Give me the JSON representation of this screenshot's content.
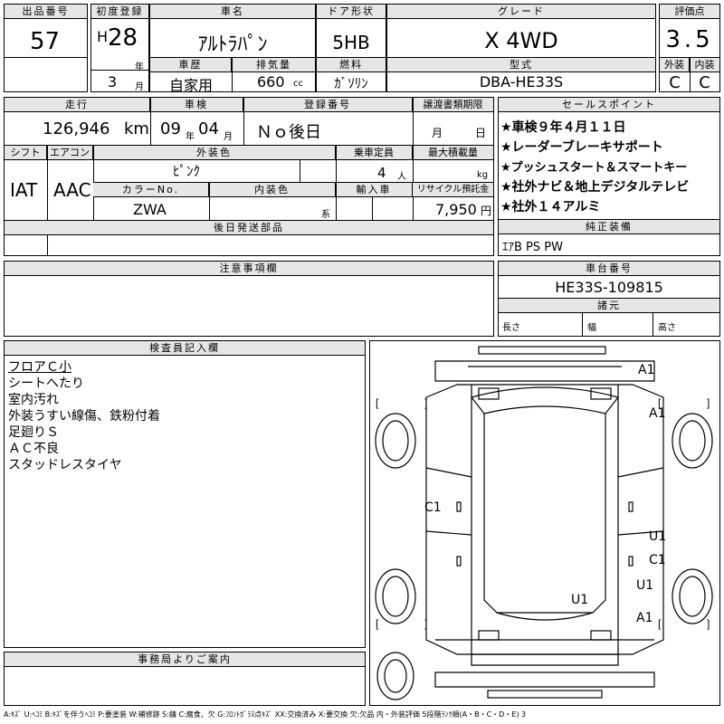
{
  "header": {
    "lot_label": "出品番号",
    "lot_no": "57",
    "first_reg_label": "初度登録",
    "era": "H",
    "year": "28",
    "year_unit": "年",
    "month": "3",
    "month_unit": "月",
    "name_label": "車名",
    "name": "ｱﾙﾄﾗﾊﾟﾝ",
    "door_label": "ドア形状",
    "door": "5HB",
    "grade_label": "グレード",
    "grade": "X 4WD",
    "score_label": "評価点",
    "score": "3.5",
    "history_label": "車歴",
    "history": "自家用",
    "disp_label": "排気量",
    "disp": "660",
    "disp_unit": "cc",
    "fuel_label": "燃料",
    "fuel": "ｶﾞｿﾘﾝ",
    "model_label": "型式",
    "model": "DBA-HE33S",
    "ext_label": "外装",
    "int_label": "内装",
    "ext": "C",
    "int": "C"
  },
  "row2": {
    "mileage_label": "走行",
    "mileage": "126,946",
    "mileage_unit": "km",
    "inspect_label": "車検",
    "inspect_y": "09",
    "inspect_y_unit": "年",
    "inspect_m": "04",
    "inspect_m_unit": "月",
    "regno_label": "登録番号",
    "regno": "Ｎｏ後日",
    "transfer_label": "譲渡書類期限",
    "transfer_m": "月",
    "transfer_d": "日",
    "shift_label": "シフト",
    "ac_label": "エアコン",
    "shift": "IAT",
    "ac": "AAC",
    "color_label": "外装色",
    "color": "ﾋﾟﾝｸ",
    "seats_label": "乗車定員",
    "seats": "4",
    "seats_unit": "人",
    "load_label": "最大積載量",
    "load_unit": "kg",
    "colorno_label": "カラーNo.",
    "colorno": "ZWA",
    "intcolor_label": "内装色",
    "intcolor_unit": "系",
    "import_label": "輸入車",
    "recycle_label": "リサイクル預託金",
    "recycle": "7,950",
    "recycle_unit": "円",
    "later_label": "後日発送部品"
  },
  "sales": {
    "label": "セールスポイント",
    "points": [
      "★車検９年４月１１日",
      "★レーダーブレーキサポート",
      "★プッシュスタート＆スマートキー",
      "★社外ナビ＆地上デジタルテレビ",
      "★社外１４アルミ"
    ],
    "equip_label": "純正装備",
    "equip": "ｴｱB PS PW"
  },
  "notes": {
    "label": "注意事項欄"
  },
  "chassis": {
    "label": "車台番号",
    "number": "HE33S-109815",
    "dims_label": "諸元",
    "length": "長さ",
    "width": "幅",
    "height": "高さ"
  },
  "inspector": {
    "label": "検査員記入欄",
    "lines": [
      "フロアＣ小",
      "シートへたり",
      "室内汚れ",
      "外装うすい線傷、鉄粉付着",
      "足廻りＳ",
      "ＡＣ不良",
      "スタッドレスタイヤ"
    ]
  },
  "office": {
    "label": "事務局よりご案内"
  },
  "diagram_marks": [
    "A1",
    "A1",
    "C1",
    "U1",
    "C1",
    "U1",
    "U1",
    "A1"
  ],
  "footer": "A:ｷｽﾞ U:ﾍｺﾐ B:ｷｽﾞを伴うﾍｺﾐ P:要塗装 W:補修跡 S:錆 C:腐食、欠 G:ﾌﾛﾝﾄｶﾞﾗｽ点ｷｽﾞ XX:交換済み X:要交換 欠:欠品 内・外装評価 5段階ﾗﾝｸ順(A・B・C・D・E) 3"
}
